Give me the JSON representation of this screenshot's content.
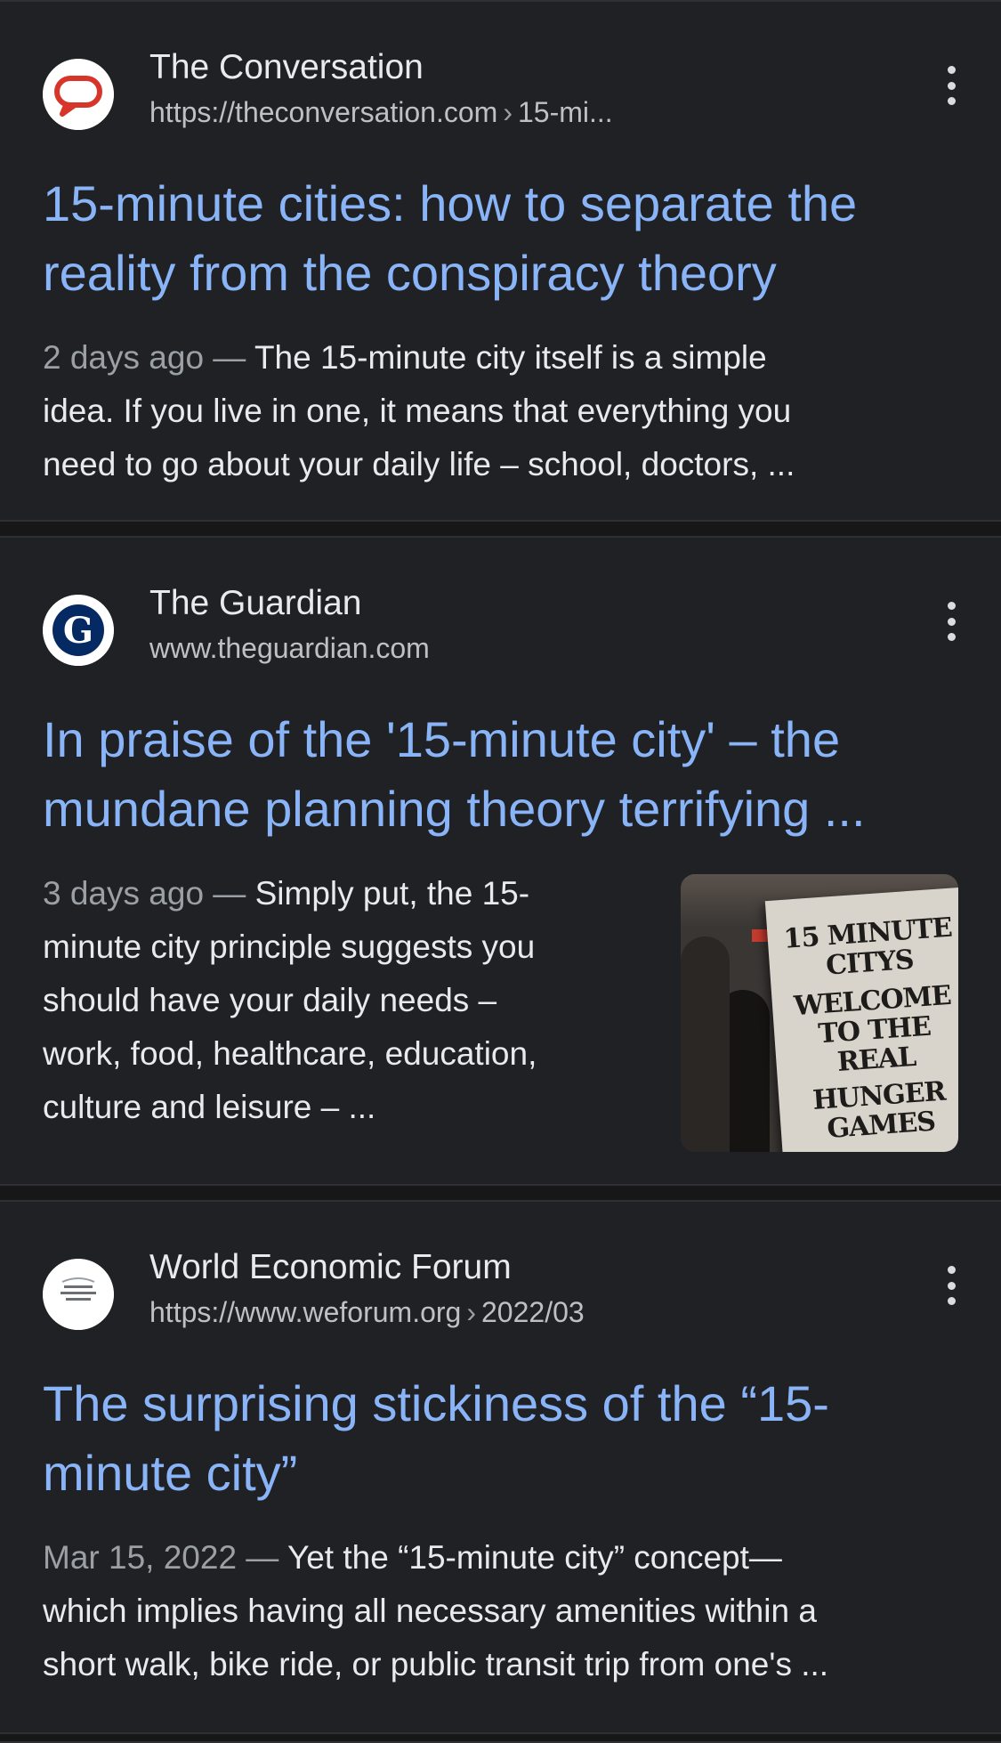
{
  "results": [
    {
      "site_name": "The Conversation",
      "url_base": "https://theconversation.com",
      "url_path": "15-mi...",
      "favicon": "conversation-speech-bubble-icon",
      "title_line1": "15-minute cities: how to separate the",
      "title_line2": "reality from the conspiracy theory",
      "date": "2 days ago",
      "snippet_line1": "The 15-minute city itself is a simple",
      "snippet_line2": "idea. If you live in one, it means that everything you",
      "snippet_line3": "need to go about your daily life – school, doctors, ..."
    },
    {
      "site_name": "The Guardian",
      "url_base": "www.theguardian.com",
      "favicon": "guardian-g-icon",
      "title_line1": "In praise of the '15-minute city' – the",
      "title_line2": "mundane planning theory terrifying ...",
      "date": "3 days ago",
      "snippet_line1": "Simply put, the 15-",
      "snippet_line2": "minute city principle suggests you",
      "snippet_line3": "should have your daily needs –",
      "snippet_line4": "work, food, healthcare, education,",
      "snippet_line5": "culture and leisure – ...",
      "thumbnail_sign": [
        "15 MINUTE",
        "CITYS",
        "WELCOME",
        "TO THE",
        "REAL",
        "HUNGER",
        "GAMES"
      ]
    },
    {
      "site_name": "World Economic Forum",
      "url_base": "https://www.weforum.org",
      "url_path": "2022/03",
      "favicon": "wef-logo-icon",
      "title_line1": "The surprising stickiness of the “15-",
      "title_line2": "minute city”",
      "date": "Mar 15, 2022",
      "snippet_line1": "Yet the “15-minute city” concept—",
      "snippet_line2": "which implies having all necessary amenities within a",
      "snippet_line3": "short walk, bike ride, or public transit trip from one's ..."
    }
  ],
  "colors": {
    "background": "#202124",
    "title_link": "#8ab4f8",
    "text": "#e8eaed",
    "muted": "#9aa0a6"
  }
}
